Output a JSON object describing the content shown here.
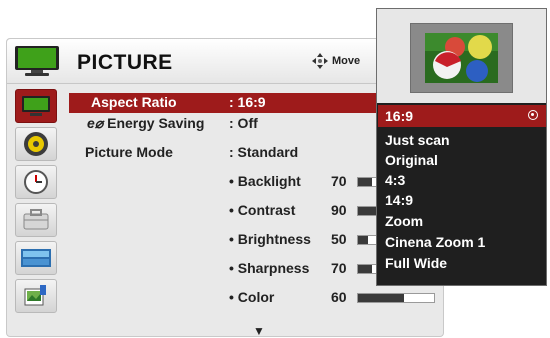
{
  "header": {
    "title": "PICTURE",
    "move_label": "Move"
  },
  "sidebar": {
    "items": [
      {
        "name": "picture",
        "icon": "tv-icon",
        "selected": true
      },
      {
        "name": "audio",
        "icon": "speaker-icon"
      },
      {
        "name": "time",
        "icon": "clock-icon"
      },
      {
        "name": "option",
        "icon": "toolbox-icon"
      },
      {
        "name": "input",
        "icon": "input-icon"
      },
      {
        "name": "usb",
        "icon": "photo-music-icon"
      }
    ]
  },
  "settings": {
    "aspect_ratio": {
      "label": "Aspect Ratio",
      "value": ": 16:9"
    },
    "energy_saving": {
      "icon": "e⌀",
      "label": "Energy Saving",
      "value": ": Off"
    },
    "picture_mode": {
      "label": "Picture Mode",
      "value": ": Standard"
    },
    "backlight": {
      "label": "• Backlight",
      "value": "70",
      "level": 0.7
    },
    "contrast": {
      "label": "• Contrast",
      "value": "90",
      "level": 0.9
    },
    "brightness": {
      "label": "• Brightness",
      "value": "50",
      "level": 0.5
    },
    "sharpness": {
      "label": "• Sharpness",
      "value": "70",
      "level": 0.7
    },
    "color": {
      "label": "• Color",
      "value": "60",
      "level": 0.6
    },
    "more_arrow": "▼"
  },
  "aspect_popup": {
    "options": [
      "16:9",
      "Just scan",
      "Original",
      "4:3",
      "14:9",
      "Zoom",
      "Cinena Zoom 1",
      "Full Wide"
    ],
    "selected_index": 0
  },
  "colors": {
    "accent": "#9e1b1b",
    "popup_bg": "#1f1f1f",
    "menu_bg": "#e9e9e9"
  }
}
